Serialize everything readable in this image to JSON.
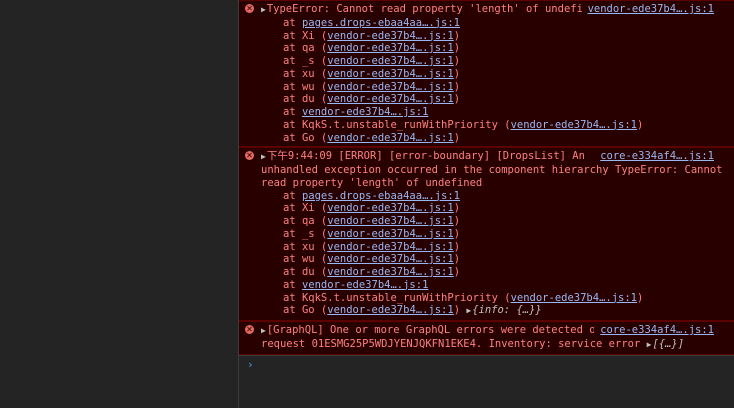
{
  "messages": [
    {
      "text_lines": [
        "TypeError: Cannot read property 'length' of undefined"
      ],
      "source": "vendor-ede37b4….js:1",
      "stack": [
        {
          "fn": "at ",
          "link": "pages.drops-ebaa4aa….js:1",
          "paren": false
        },
        {
          "fn": "at Xi (",
          "link": "vendor-ede37b4….js:1",
          "paren": true
        },
        {
          "fn": "at qa (",
          "link": "vendor-ede37b4….js:1",
          "paren": true
        },
        {
          "fn": "at _s (",
          "link": "vendor-ede37b4….js:1",
          "paren": true
        },
        {
          "fn": "at xu (",
          "link": "vendor-ede37b4….js:1",
          "paren": true
        },
        {
          "fn": "at wu (",
          "link": "vendor-ede37b4….js:1",
          "paren": true
        },
        {
          "fn": "at du (",
          "link": "vendor-ede37b4….js:1",
          "paren": true
        },
        {
          "fn": "at ",
          "link": "vendor-ede37b4….js:1",
          "paren": false
        },
        {
          "fn": "at KqkS.t.unstable_runWithPriority (",
          "link": "vendor-ede37b4….js:1",
          "paren": true
        },
        {
          "fn": "at Go (",
          "link": "vendor-ede37b4….js:1",
          "paren": true
        }
      ]
    },
    {
      "text_lines": [
        "下午9:44:09 [ERROR] [error-boundary] [DropsList] An",
        "unhandled exception occurred in the component hierarchy TypeError: Cannot",
        "read property 'length' of undefined"
      ],
      "source": "core-e334af4….js:1",
      "stack": [
        {
          "fn": "at ",
          "link": "pages.drops-ebaa4aa….js:1",
          "paren": false
        },
        {
          "fn": "at Xi (",
          "link": "vendor-ede37b4….js:1",
          "paren": true
        },
        {
          "fn": "at qa (",
          "link": "vendor-ede37b4….js:1",
          "paren": true
        },
        {
          "fn": "at _s (",
          "link": "vendor-ede37b4….js:1",
          "paren": true
        },
        {
          "fn": "at xu (",
          "link": "vendor-ede37b4….js:1",
          "paren": true
        },
        {
          "fn": "at wu (",
          "link": "vendor-ede37b4….js:1",
          "paren": true
        },
        {
          "fn": "at du (",
          "link": "vendor-ede37b4….js:1",
          "paren": true
        },
        {
          "fn": "at ",
          "link": "vendor-ede37b4….js:1",
          "paren": false
        },
        {
          "fn": "at KqkS.t.unstable_runWithPriority (",
          "link": "vendor-ede37b4….js:1",
          "paren": true
        },
        {
          "fn": "at Go (",
          "link": "vendor-ede37b4….js:1",
          "paren": true,
          "obj": "{info: {…}}"
        }
      ]
    },
    {
      "text_lines": [
        "[GraphQL] One or more GraphQL errors were detected on",
        "request 01ESMG25P5WDJYENJQKFN1EKE4. Inventory: service error"
      ],
      "source": "core-e334af4….js:1",
      "trailing_obj": "[{…}]",
      "stack": []
    }
  ],
  "prompt_symbol": "›",
  "icons": {
    "error": "error-circle-icon",
    "expand": "expand-triangle-icon"
  },
  "colors": {
    "error_bg": "#290000",
    "error_text": "#fe8080",
    "link": "#9ab6f2"
  }
}
